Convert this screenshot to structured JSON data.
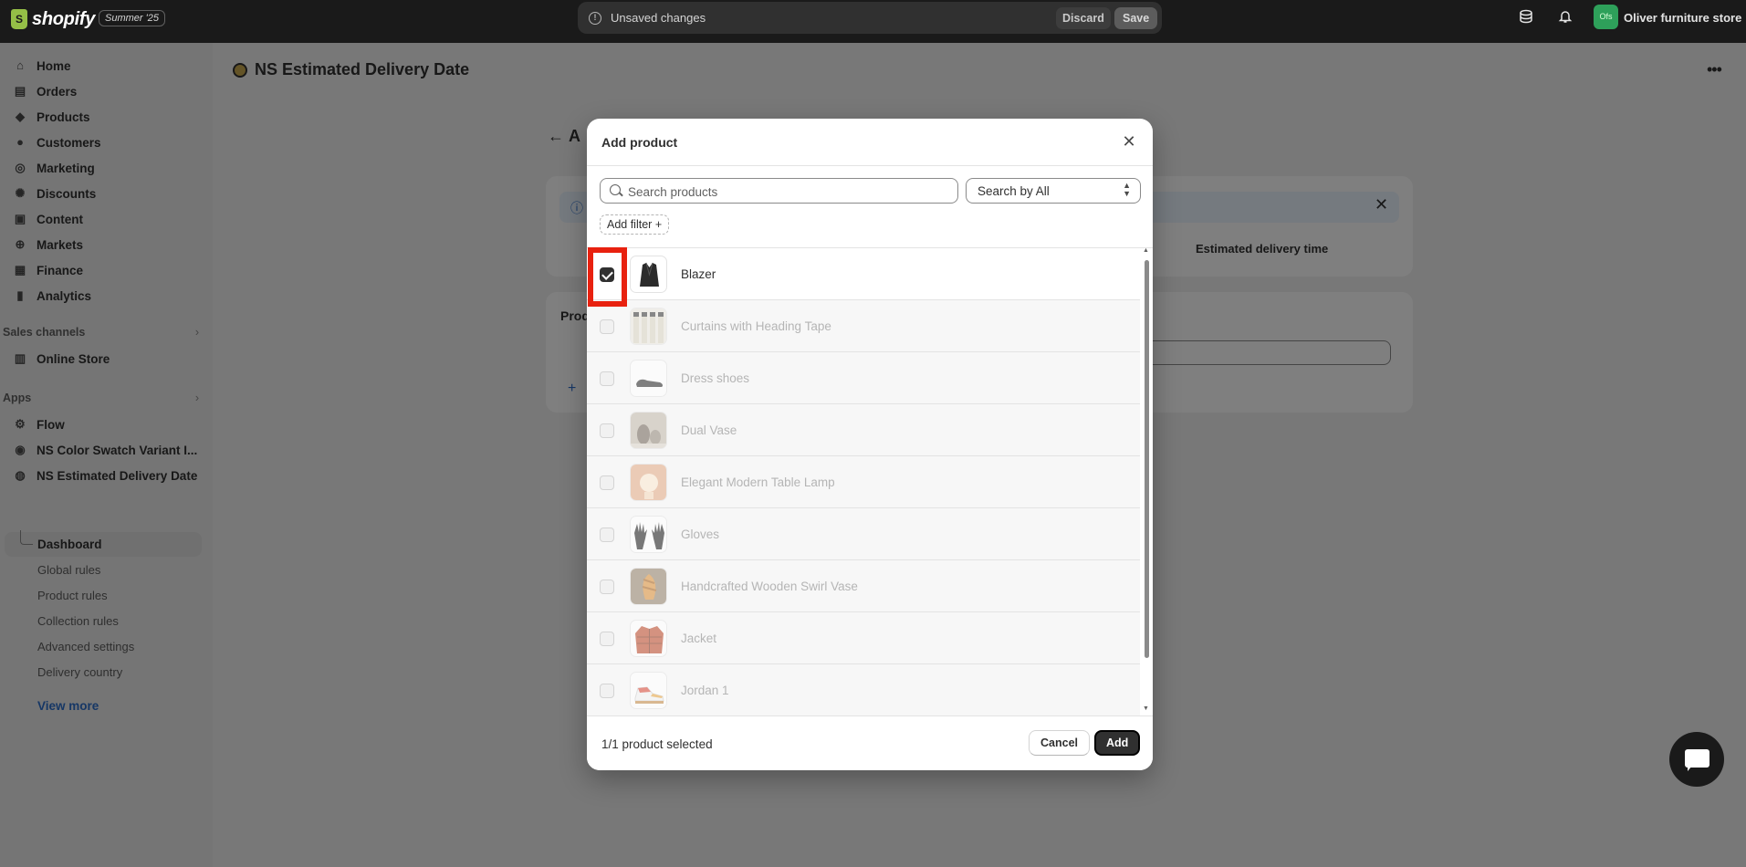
{
  "topbar": {
    "brand": "shopify",
    "edition": "Summer '25",
    "unsaved_message": "Unsaved changes",
    "discard_label": "Discard",
    "save_label": "Save",
    "store_initials": "Ofs",
    "store_name": "Oliver furniture store"
  },
  "sidebar": {
    "main_nav": [
      {
        "label": "Home",
        "icon": "home-icon"
      },
      {
        "label": "Orders",
        "icon": "inbox-icon"
      },
      {
        "label": "Products",
        "icon": "tag-icon"
      },
      {
        "label": "Customers",
        "icon": "person-icon"
      },
      {
        "label": "Marketing",
        "icon": "target-icon"
      },
      {
        "label": "Discounts",
        "icon": "discount-icon"
      },
      {
        "label": "Content",
        "icon": "content-icon"
      },
      {
        "label": "Markets",
        "icon": "globe-icon"
      },
      {
        "label": "Finance",
        "icon": "bank-icon"
      },
      {
        "label": "Analytics",
        "icon": "bar-chart-icon"
      }
    ],
    "sales_channels_header": "Sales channels",
    "online_store": "Online Store",
    "apps_header": "Apps",
    "apps": [
      {
        "label": "Flow",
        "icon": "flow-icon"
      },
      {
        "label": "NS Color Swatch Variant I...",
        "icon": "color-swatch-app-icon"
      },
      {
        "label": "NS Estimated Delivery Date",
        "icon": "delivery-app-icon"
      }
    ],
    "app_sub_items": [
      "Dashboard",
      "Global rules",
      "Product rules",
      "Collection rules",
      "Advanced settings",
      "Delivery country"
    ],
    "view_more": "View more"
  },
  "main": {
    "page_title": "NS Estimated Delivery Date",
    "back_heading_initial": "A",
    "products_card_initial": "Prod",
    "column_header": "Estimated delivery time"
  },
  "modal": {
    "title": "Add product",
    "search_placeholder": "Search products",
    "search_by_label": "Search by All",
    "add_filter_label": "Add filter",
    "products": [
      {
        "name": "Blazer",
        "selected": true,
        "thumb": "blazer"
      },
      {
        "name": "Curtains with Heading Tape",
        "selected": false,
        "thumb": "curtains"
      },
      {
        "name": "Dress shoes",
        "selected": false,
        "thumb": "shoes"
      },
      {
        "name": "Dual Vase",
        "selected": false,
        "thumb": "vase"
      },
      {
        "name": "Elegant Modern Table Lamp",
        "selected": false,
        "thumb": "lamp"
      },
      {
        "name": "Gloves",
        "selected": false,
        "thumb": "gloves"
      },
      {
        "name": "Handcrafted Wooden Swirl Vase",
        "selected": false,
        "thumb": "swirl-vase"
      },
      {
        "name": "Jacket",
        "selected": false,
        "thumb": "jacket"
      },
      {
        "name": "Jordan 1",
        "selected": false,
        "thumb": "sneaker"
      }
    ],
    "selected_count_text": "1/1 product selected",
    "cancel_label": "Cancel",
    "add_label": "Add"
  },
  "colors": {
    "topbar_bg": "#1a1a1a",
    "accent_link": "#2c6ecb",
    "primary_button": "#303030",
    "highlight_annotation": "#e8210f",
    "avatar_bg": "#2ea05a"
  }
}
